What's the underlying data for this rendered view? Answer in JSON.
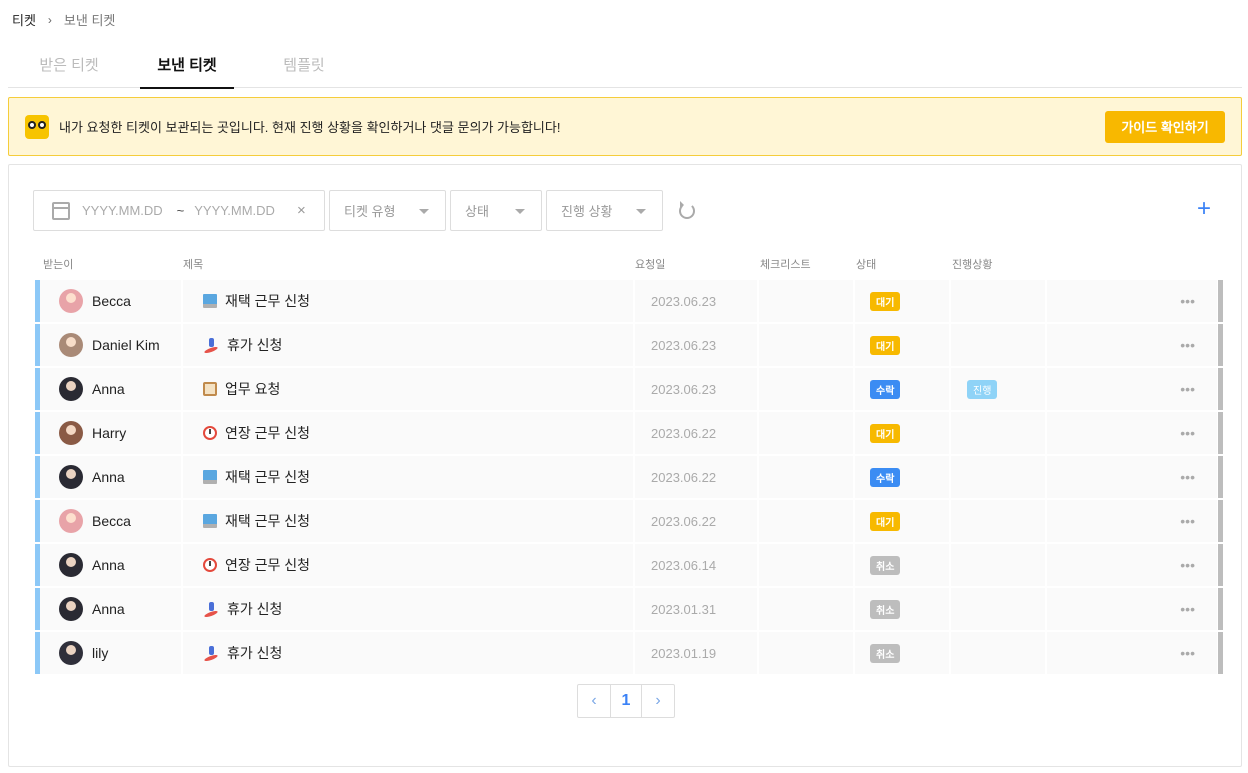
{
  "breadcrumb": {
    "root": "티켓",
    "current": "보낸 티켓"
  },
  "tabs": [
    {
      "label": "받은 티켓",
      "active": false
    },
    {
      "label": "보낸 티켓",
      "active": true
    },
    {
      "label": "템플릿",
      "active": false
    }
  ],
  "banner": {
    "message": "내가 요청한 티켓이 보관되는 곳입니다. 현재 진행 상황을 확인하거나 댓글 문의가 가능합니다!",
    "button_label": "가이드 확인하기"
  },
  "filters": {
    "date_start_placeholder": "YYYY.MM.DD",
    "date_separator": "~",
    "date_end_placeholder": "YYYY.MM.DD",
    "clear_symbol": "×",
    "type_label": "티켓 유형",
    "status_label": "상태",
    "progress_label": "진행 상황",
    "add_symbol": "+"
  },
  "columns": {
    "receiver": "받는이",
    "title": "제목",
    "date": "요청일",
    "checklist": "체크리스트",
    "status": "상태",
    "progress": "진행상황"
  },
  "rows": [
    {
      "receiver": "Becca",
      "avatar": "becca",
      "icon": "laptop-icon",
      "title": "재택 근무 신청",
      "date": "2023.06.23",
      "status": "대기",
      "status_kind": "wait",
      "progress": ""
    },
    {
      "receiver": "Daniel Kim",
      "avatar": "daniel",
      "icon": "surfer-icon",
      "title": "휴가 신청",
      "date": "2023.06.23",
      "status": "대기",
      "status_kind": "wait",
      "progress": ""
    },
    {
      "receiver": "Anna",
      "avatar": "anna",
      "icon": "clipboard-icon",
      "title": "업무 요청",
      "date": "2023.06.23",
      "status": "수락",
      "status_kind": "accept",
      "progress": "진행"
    },
    {
      "receiver": "Harry",
      "avatar": "harry",
      "icon": "alarm-clock-icon",
      "title": "연장 근무 신청",
      "date": "2023.06.22",
      "status": "대기",
      "status_kind": "wait",
      "progress": ""
    },
    {
      "receiver": "Anna",
      "avatar": "anna",
      "icon": "laptop-icon",
      "title": "재택 근무 신청",
      "date": "2023.06.22",
      "status": "수락",
      "status_kind": "accept",
      "progress": ""
    },
    {
      "receiver": "Becca",
      "avatar": "becca",
      "icon": "laptop-icon",
      "title": "재택 근무 신청",
      "date": "2023.06.22",
      "status": "대기",
      "status_kind": "wait",
      "progress": ""
    },
    {
      "receiver": "Anna",
      "avatar": "anna",
      "icon": "alarm-clock-icon",
      "title": "연장 근무 신청",
      "date": "2023.06.14",
      "status": "취소",
      "status_kind": "cancel",
      "progress": ""
    },
    {
      "receiver": "Anna",
      "avatar": "anna",
      "icon": "surfer-icon",
      "title": "휴가 신청",
      "date": "2023.01.31",
      "status": "취소",
      "status_kind": "cancel",
      "progress": ""
    },
    {
      "receiver": "lily",
      "avatar": "lily",
      "icon": "surfer-icon",
      "title": "휴가 신청",
      "date": "2023.01.19",
      "status": "취소",
      "status_kind": "cancel",
      "progress": ""
    }
  ],
  "row_more_symbol": "•••",
  "pagination": {
    "prev": "‹",
    "current": "1",
    "next": "›"
  },
  "colors": {
    "accent": "#3b82f6",
    "warning": "#f8b800",
    "cancel": "#bdbdbd",
    "row_marker": "#8cc8f7"
  }
}
